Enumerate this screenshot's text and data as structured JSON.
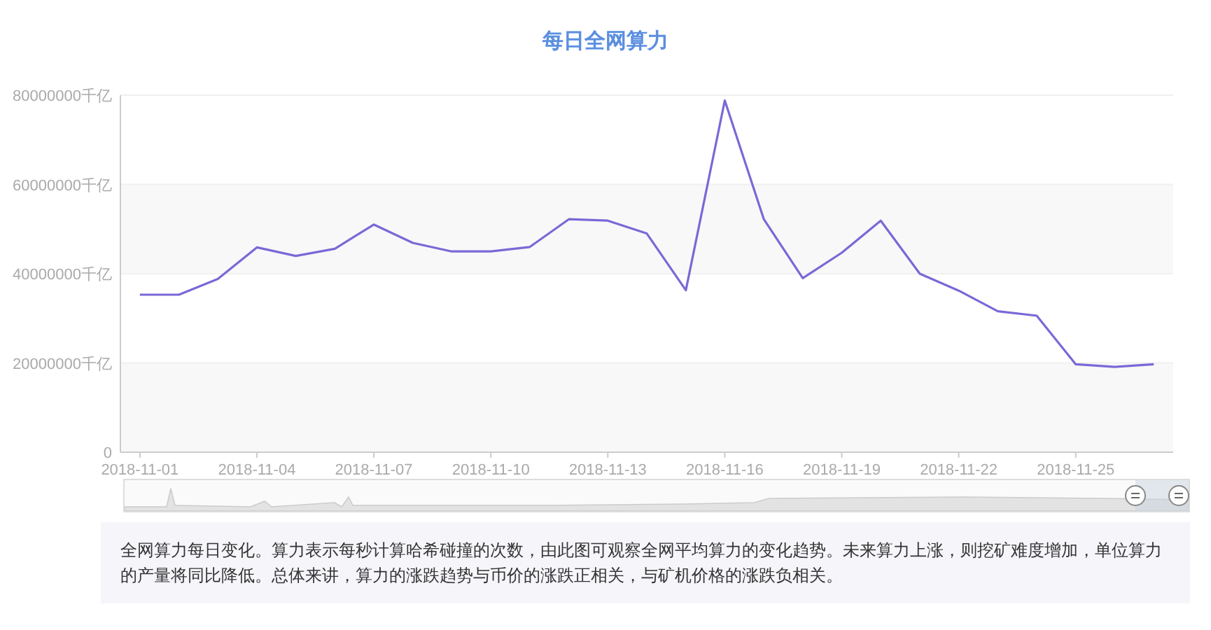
{
  "title": "每日全网算力",
  "chart_data": {
    "type": "line",
    "grid": true,
    "categories": [
      "2018-11-01",
      null,
      null,
      "2018-11-04",
      null,
      null,
      "2018-11-07",
      null,
      null,
      "2018-11-10",
      null,
      null,
      "2018-11-13",
      null,
      null,
      "2018-11-16",
      null,
      null,
      "2018-11-19",
      null,
      null,
      "2018-11-22",
      null,
      null,
      "2018-11-25",
      null,
      null
    ],
    "ylim": [
      0,
      80000000
    ],
    "yticks": [
      {
        "value": 0,
        "label": "0"
      },
      {
        "value": 20000000,
        "label": "20000000千亿"
      },
      {
        "value": 40000000,
        "label": "40000000千亿"
      },
      {
        "value": 60000000,
        "label": "60000000千亿"
      },
      {
        "value": 80000000,
        "label": "80000000千亿"
      }
    ],
    "series": [
      {
        "color": "#7b68d6",
        "values": [
          35300000,
          35300000,
          38800000,
          45900000,
          44000000,
          45600000,
          51000000,
          46900000,
          45000000,
          45000000,
          46000000,
          52200000,
          51900000,
          49000000,
          36300000,
          78800000,
          52200000,
          39000000,
          44700000,
          51900000,
          40000000,
          36200000,
          31600000,
          30600000,
          19700000,
          19100000,
          19700000
        ]
      }
    ]
  },
  "zoom_slider": {
    "level": 0.95
  },
  "description": "全网算力每日变化。算力表示每秒计算哈希碰撞的次数，由此图可观察全网平均算力的变化趋势。未来算力上涨，则挖矿难度增加，单位算力的产量将同比降低。总体来讲，算力的涨跌趋势与币价的涨跌正相关，与矿机价格的涨跌负相关。"
}
